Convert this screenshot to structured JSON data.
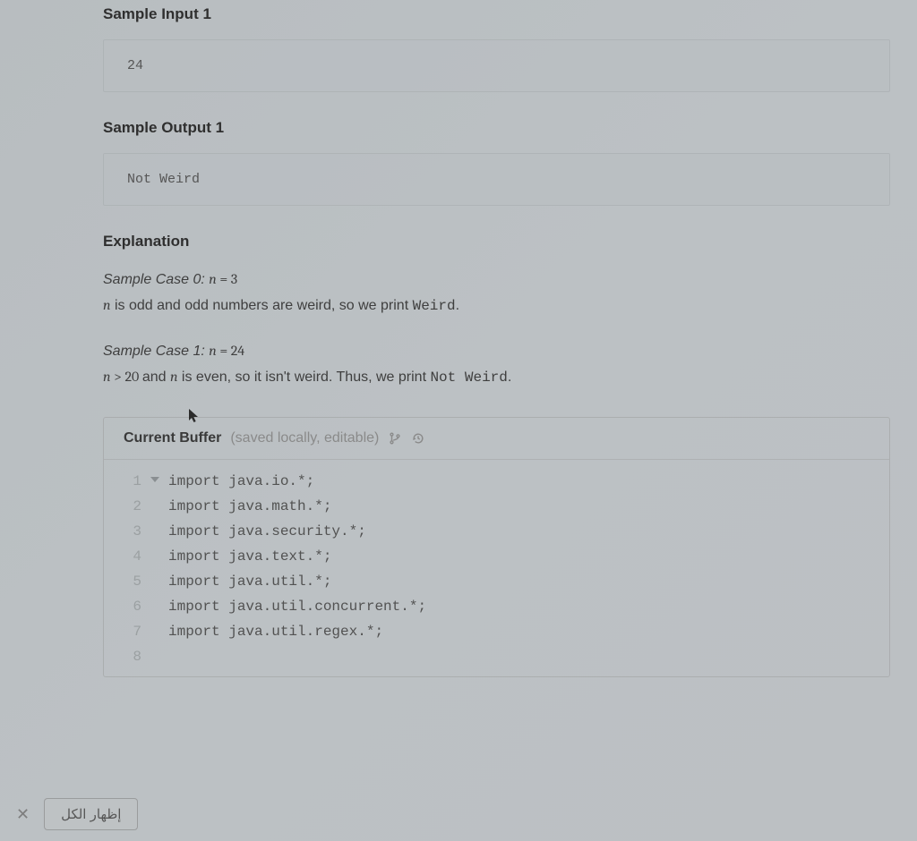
{
  "headings": {
    "sample_input_1": "Sample Input 1",
    "sample_output_1": "Sample Output 1",
    "explanation": "Explanation"
  },
  "samples": {
    "input1": "24",
    "output1": "Not Weird"
  },
  "explanation": {
    "case0_label": "Sample Case 0:",
    "case0_expr_var": "n",
    "case0_expr_eq": "=",
    "case0_expr_val": "3",
    "case0_line_pre": " is odd and odd numbers are weird, so we print ",
    "case0_line_code": "Weird",
    "case0_line_post": ".",
    "case1_label": "Sample Case 1:",
    "case1_expr_var": "n",
    "case1_expr_eq": "=",
    "case1_expr_val": "24",
    "case1_line_var": "n",
    "case1_line_gt": ">",
    "case1_line_num": "20",
    "case1_line_mid": " and ",
    "case1_line_var2": "n",
    "case1_line_tail": " is even, so it isn't weird. Thus, we print ",
    "case1_line_code": "Not Weird",
    "case1_line_post": "."
  },
  "editor": {
    "title": "Current Buffer",
    "subtitle": "(saved locally, editable)",
    "lines": [
      "import java.io.*;",
      "import java.math.*;",
      "import java.security.*;",
      "import java.text.*;",
      "import java.util.*;",
      "import java.util.concurrent.*;",
      "import java.util.regex.*;",
      ""
    ],
    "line_numbers": [
      "1",
      "2",
      "3",
      "4",
      "5",
      "6",
      "7",
      "8"
    ]
  },
  "bottom": {
    "button_label": "إظهار الكل"
  }
}
